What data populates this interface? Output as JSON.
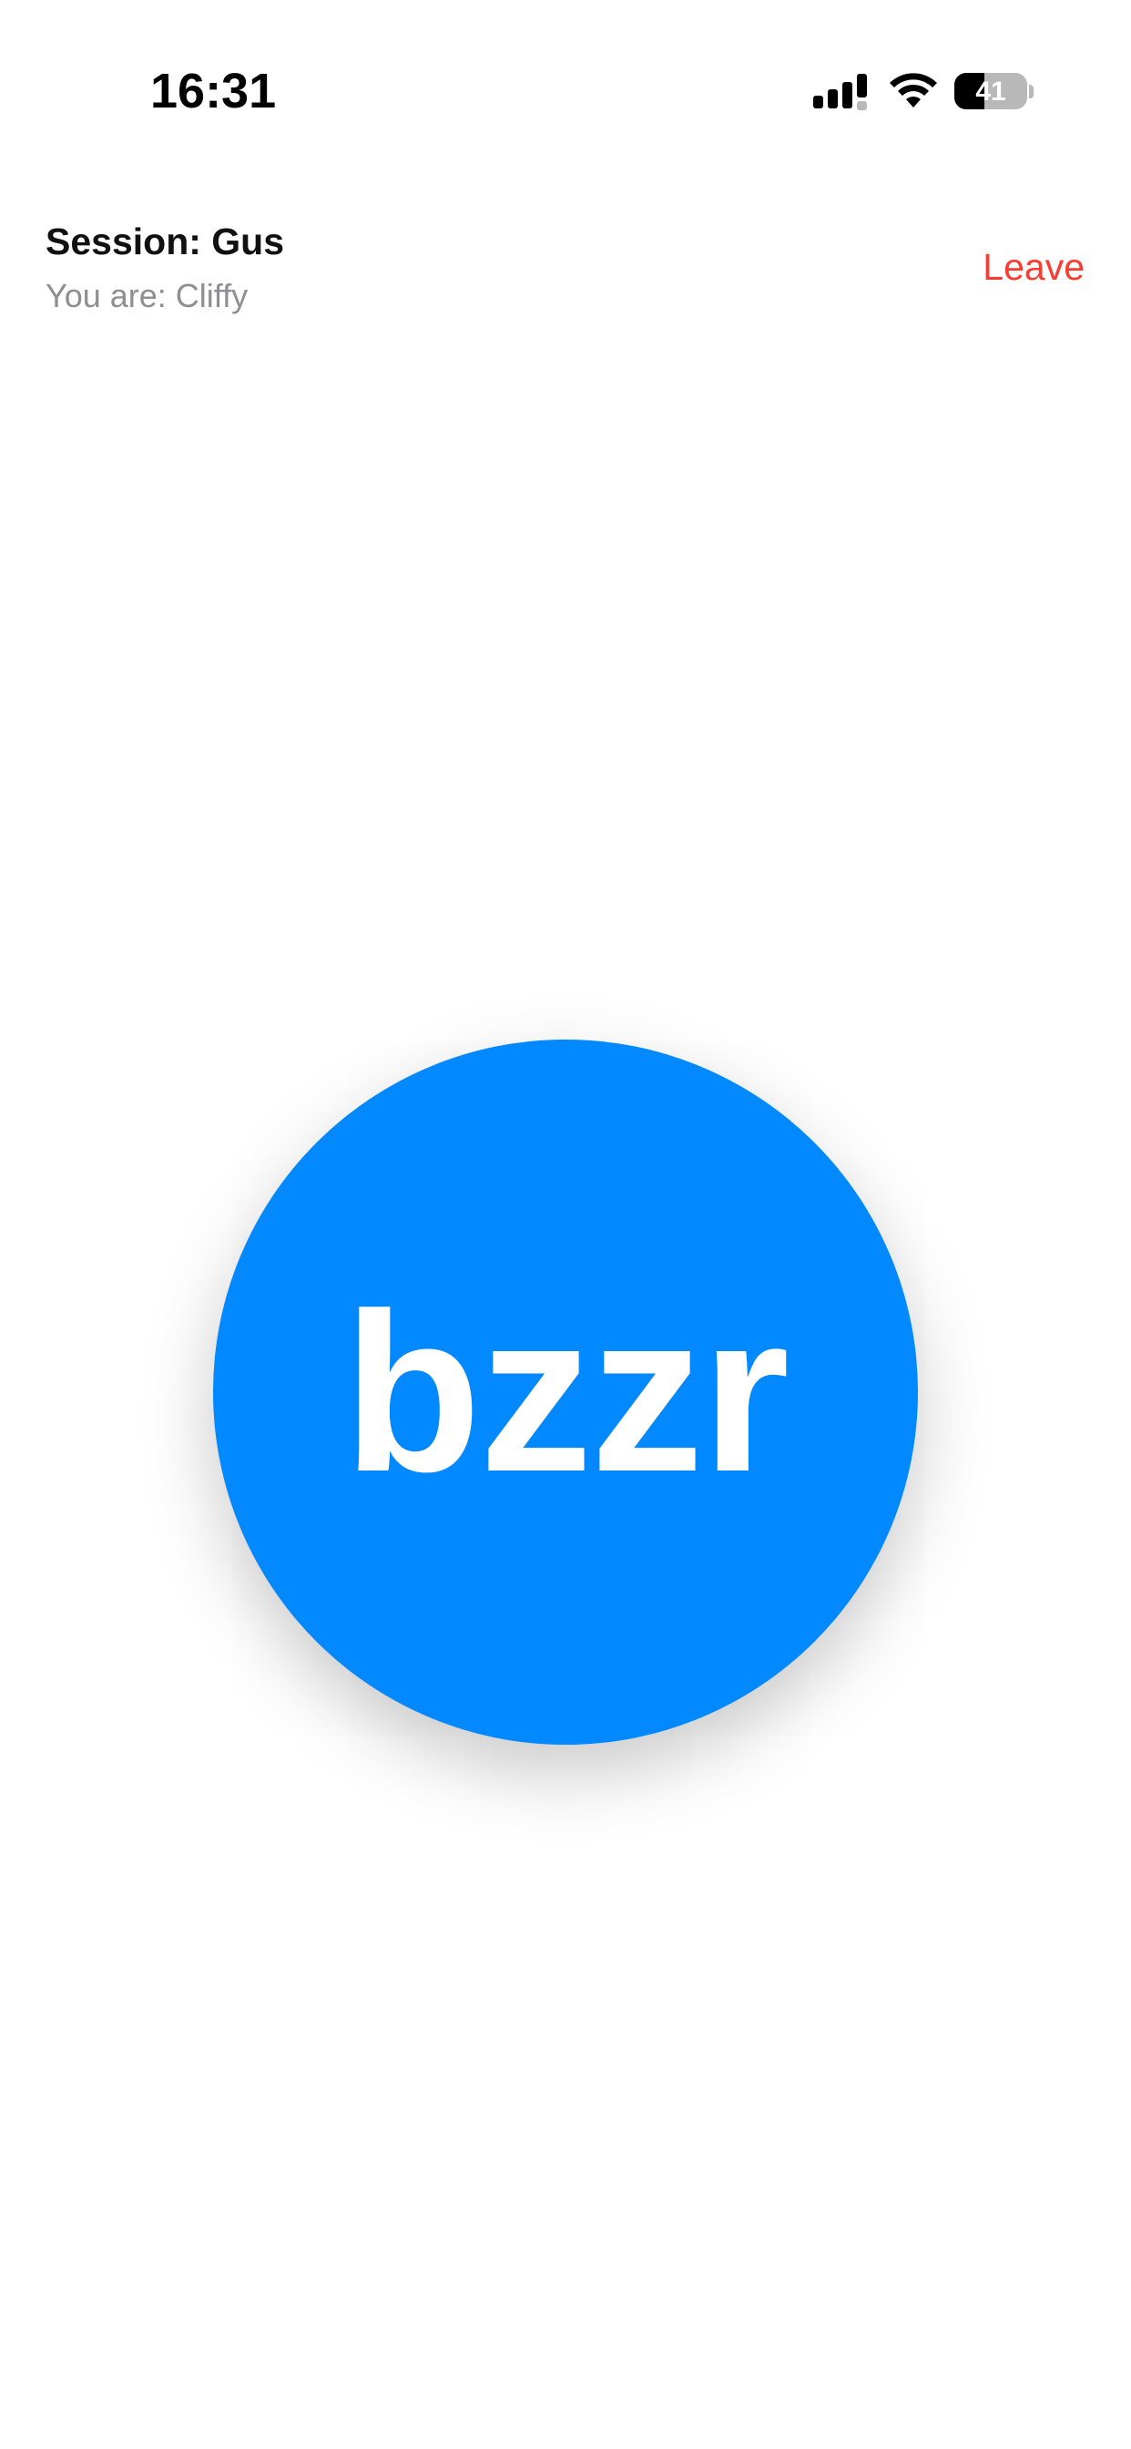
{
  "status_bar": {
    "time": "16:31",
    "signal_icon": "cellular-signal-icon",
    "wifi_icon": "wifi-icon",
    "battery_level": "41",
    "battery_fraction": 0.41
  },
  "header": {
    "session_title": "Session: Gus",
    "you_are": "You are: Cliffy",
    "leave_label": "Leave"
  },
  "buzzer": {
    "label": "bzzr"
  },
  "colors": {
    "accent": "#0288ff",
    "destructive": "#ff3b30",
    "secondary_text": "#8e8e93",
    "background": "#ffffff"
  }
}
